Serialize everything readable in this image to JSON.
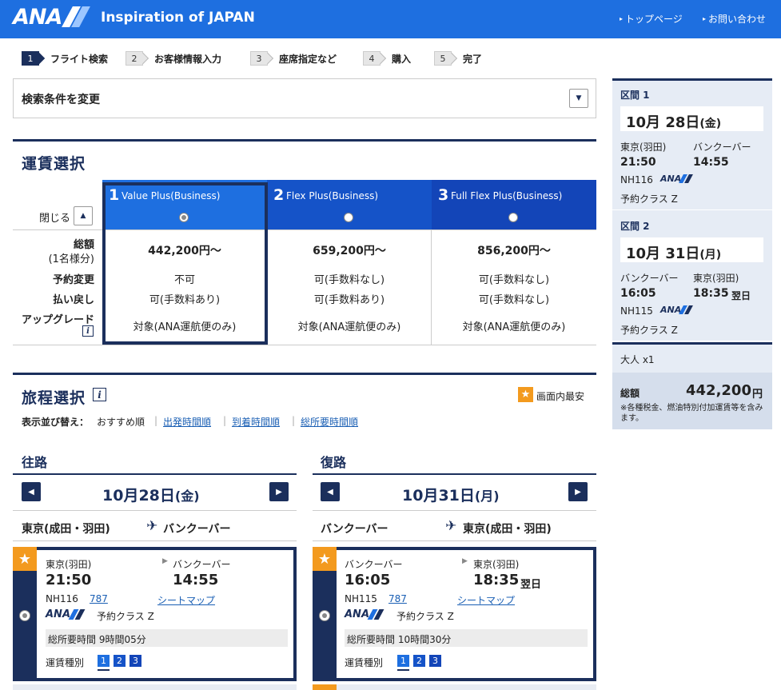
{
  "header": {
    "brand": "ANA",
    "tagline": "Inspiration of JAPAN",
    "links": [
      "トップページ",
      "お問い合わせ"
    ]
  },
  "steps": [
    {
      "num": "1",
      "label": "フライト検索"
    },
    {
      "num": "2",
      "label": "お客様情報入力"
    },
    {
      "num": "3",
      "label": "座席指定など"
    },
    {
      "num": "4",
      "label": "購入"
    },
    {
      "num": "5",
      "label": "完了"
    }
  ],
  "search": {
    "label": "検索条件を変更"
  },
  "fare": {
    "title": "運賃選択",
    "close_label": "閉じる",
    "row_labels": {
      "total": "総額",
      "total_sub": "(1名様分)",
      "change": "予約変更",
      "refund": "払い戻し",
      "upgrade": "アップグレード"
    },
    "options": [
      {
        "num": "1",
        "name": "Value Plus(Business)",
        "price": "442,200円〜",
        "change": "不可",
        "refund": "可(手数料あり)",
        "upgrade": "対象(ANA運航便のみ)"
      },
      {
        "num": "2",
        "name": "Flex Plus(Business)",
        "price": "659,200円〜",
        "change": "可(手数料なし)",
        "refund": "可(手数料あり)",
        "upgrade": "対象(ANA運航便のみ)"
      },
      {
        "num": "3",
        "name": "Full Flex Plus(Business)",
        "price": "856,200円〜",
        "change": "可(手数料なし)",
        "refund": "可(手数料なし)",
        "upgrade": "対象(ANA運航便のみ)"
      }
    ],
    "colors": {
      "selected": "#1e6fe0",
      "col2": "#1553c8",
      "col3": "#1345b8",
      "border": "#1b2f5c"
    }
  },
  "itinerary": {
    "title": "旅程選択",
    "cheapest_label": "画面内最安",
    "sort_label": "表示並び替え：",
    "sort_current": "おすすめ順",
    "sort_links": [
      "出発時間順",
      "到着時間順",
      "総所要時間順"
    ],
    "outbound": {
      "label": "往路",
      "date_num": "10月28日",
      "date_wd": "(金)",
      "from": "東京(成田・羽田)",
      "to": "バンクーバー",
      "flight": {
        "dep_city": "東京(羽田)",
        "arr_city": "バンクーバー",
        "dep_time": "21:50",
        "arr_time": "14:55",
        "arr_next": "",
        "flight_no": "NH116",
        "aircraft": "787",
        "seatmap": "シートマップ",
        "airline": "ANA",
        "class": "予約クラス Z",
        "duration": "総所要時間 9時間05分",
        "fare_label": "運賃種別",
        "fare_types": [
          "1",
          "2",
          "3"
        ]
      }
    },
    "return": {
      "label": "復路",
      "date_num": "10月31日",
      "date_wd": "(月)",
      "from": "バンクーバー",
      "to": "東京(成田・羽田)",
      "flight": {
        "dep_city": "バンクーバー",
        "arr_city": "東京(羽田)",
        "dep_time": "16:05",
        "arr_time": "18:35",
        "arr_next": "翌日",
        "flight_no": "NH115",
        "aircraft": "787",
        "seatmap": "シートマップ",
        "airline": "ANA",
        "class": "予約クラス Z",
        "duration": "総所要時間 10時間30分",
        "fare_label": "運賃種別",
        "fare_types": [
          "1",
          "2",
          "3"
        ]
      }
    }
  },
  "summary": {
    "seg1": {
      "title": "区間 1",
      "date": "10月 28日",
      "wd": "(金)",
      "dep_city": "東京(羽田)",
      "arr_city": "バンクーバー",
      "dep_time": "21:50",
      "arr_time": "14:55",
      "arr_next": "",
      "flight_no": "NH116",
      "airline": "ANA",
      "class": "予約クラス Z"
    },
    "seg2": {
      "title": "区間 2",
      "date": "10月 31日",
      "wd": "(月)",
      "dep_city": "バンクーバー",
      "arr_city": "東京(羽田)",
      "dep_time": "16:05",
      "arr_time": "18:35",
      "arr_next": "翌日",
      "flight_no": "NH115",
      "airline": "ANA",
      "class": "予約クラス Z"
    },
    "pax": "大人 x1",
    "total_label": "総額",
    "total_value": "442,200",
    "total_unit": "円",
    "note": "※各種税金、燃油特別付加運賃等を含みます。"
  }
}
